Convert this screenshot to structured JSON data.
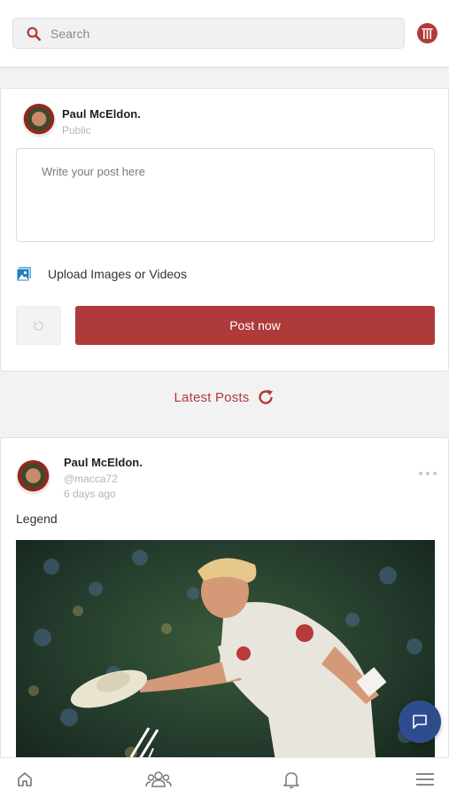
{
  "search": {
    "placeholder": "Search"
  },
  "composer": {
    "user_name": "Paul McEldon.",
    "visibility": "Public",
    "post_placeholder": "Write your post here",
    "upload_label": "Upload Images or Videos",
    "post_button": "Post now"
  },
  "latest": {
    "label": "Latest Posts"
  },
  "post": {
    "user_name": "Paul McEldon.",
    "handle": "@macca72",
    "time": "6 days ago",
    "text": "Legend"
  },
  "icons": {
    "search": "search-icon",
    "logo": "cricket-stumps-logo",
    "upload": "image-icon",
    "refresh_small": "refresh-icon",
    "latest_refresh": "refresh-icon",
    "more": "more-horizontal-icon",
    "chat": "chat-icon",
    "home": "home-icon",
    "groups": "groups-icon",
    "notifications": "bell-icon",
    "menu": "hamburger-menu-icon"
  },
  "colors": {
    "accent": "#ae3a3a",
    "fab": "#2e4d8f"
  }
}
